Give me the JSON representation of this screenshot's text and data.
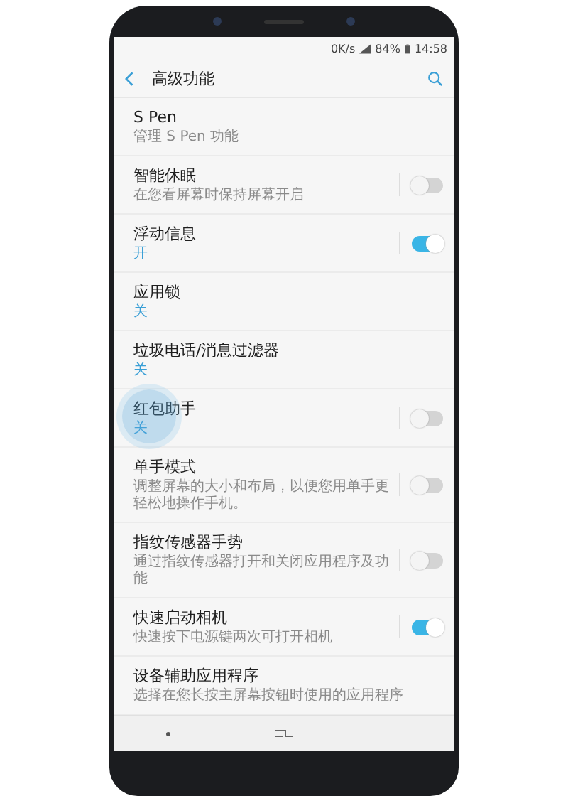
{
  "status_bar": {
    "speed": "0K/s",
    "battery": "84%",
    "time": "14:58"
  },
  "header": {
    "title": "高级功能"
  },
  "items": [
    {
      "kind": "plain",
      "title": "S Pen",
      "subtitle": "管理 S Pen 功能",
      "accent": false
    },
    {
      "kind": "toggle",
      "title": "智能休眠",
      "subtitle": "在您看屏幕时保持屏幕开启",
      "accent": false,
      "on": false
    },
    {
      "kind": "toggle",
      "title": "浮动信息",
      "subtitle": "开",
      "accent": true,
      "on": true
    },
    {
      "kind": "plain",
      "title": "应用锁",
      "subtitle": "关",
      "accent": true
    },
    {
      "kind": "plain",
      "title": "垃圾电话/消息过滤器",
      "subtitle": "关",
      "accent": true
    },
    {
      "kind": "toggle",
      "title": "红包助手",
      "subtitle": "关",
      "accent": true,
      "on": false,
      "touched": true
    },
    {
      "kind": "toggle",
      "title": "单手模式",
      "subtitle": "调整屏幕的大小和布局，以便您用单手更轻松地操作手机。",
      "accent": false,
      "on": false
    },
    {
      "kind": "toggle",
      "title": "指纹传感器手势",
      "subtitle": "通过指纹传感器打开和关闭应用程序及功能",
      "accent": false,
      "on": false
    },
    {
      "kind": "toggle",
      "title": "快速启动相机",
      "subtitle": "快速按下电源键两次可打开相机",
      "accent": false,
      "on": true
    },
    {
      "kind": "plain",
      "title": "设备辅助应用程序",
      "subtitle": "选择在您长按主屏幕按钮时使用的应用程序",
      "accent": false
    }
  ]
}
